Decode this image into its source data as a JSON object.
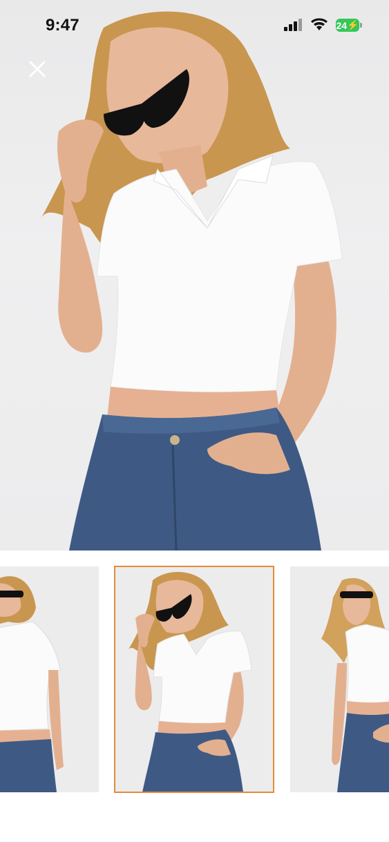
{
  "status_bar": {
    "time": "9:47",
    "battery": "24"
  },
  "gallery": {
    "selected_index": 1,
    "thumbnail_count": 3,
    "accent_color": "#e48a3a"
  },
  "icons": {
    "close": "close-icon",
    "signal": "cellular-signal-icon",
    "wifi": "wifi-icon",
    "battery": "battery-charging-icon"
  }
}
